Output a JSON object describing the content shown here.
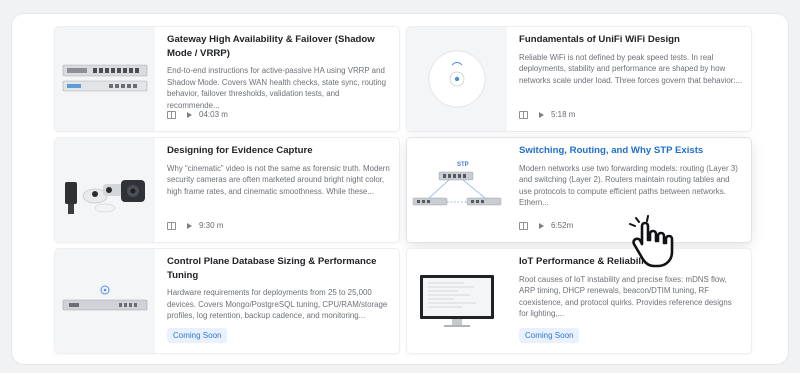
{
  "cards": [
    {
      "title": "Gateway High Availability & Failover (Shadow Mode / VRRP)",
      "description": "End-to-end instructions for active-passive HA using VRRP and Shadow Mode. Covers WAN health checks, state sync, routing behavior, failover thresholds, validation tests, and recommende...",
      "duration": "04:03 m",
      "thumbnail": "rack-gateway"
    },
    {
      "title": "Fundamentals of UniFi WiFi Design",
      "description": "Reliable WiFi is not defined by peak speed tests. In real deployments, stability and performance are shaped by how networks scale under load. Three forces govern that behavior:...",
      "duration": "5:18 m",
      "thumbnail": "access-point"
    },
    {
      "title": "Designing for Evidence Capture",
      "description": "Why “cinematic” video is not the same as forensic truth. Modern security cameras are often marketed around bright night color, high frame rates, and cinematic smoothness. While these...",
      "duration": "9:30 m",
      "thumbnail": "cameras"
    },
    {
      "title": "Switching, Routing, and Why STP Exists",
      "description": "Modern networks use two forwarding models: routing (Layer 3) and switching (Layer 2). Routers maintain routing tables and use protocols to compute efficient paths between networks. Ethern...",
      "duration": "6:52m",
      "thumbnail": "stp-diagram",
      "diagram_label": "STP"
    },
    {
      "title": "Control Plane Database Sizing & Performance Tuning",
      "description": "Hardware requirements for deployments from 25 to 25,000 devices. Covers Mongo/PostgreSQL tuning, CPU/RAM/storage profiles, log retention, backup cadence, and monitoring...",
      "badge": "Coming Soon",
      "thumbnail": "server"
    },
    {
      "title": "IoT Performance & Reliability Gu",
      "description": "Root causes of IoT instability and precise fixes: mDNS flow, ARP timing, DHCP renewals, beacon/DTIM tuning, RF coexistence, and protocol quirks. Provides reference designs for lighting,...",
      "badge": "Coming Soon",
      "thumbnail": "monitor"
    }
  ],
  "colors": {
    "accent": "#1f6fd0",
    "badge_bg": "#e8f1fd",
    "badge_text": "#2e78d6"
  },
  "cursor_icon": "hand-pointer-icon"
}
